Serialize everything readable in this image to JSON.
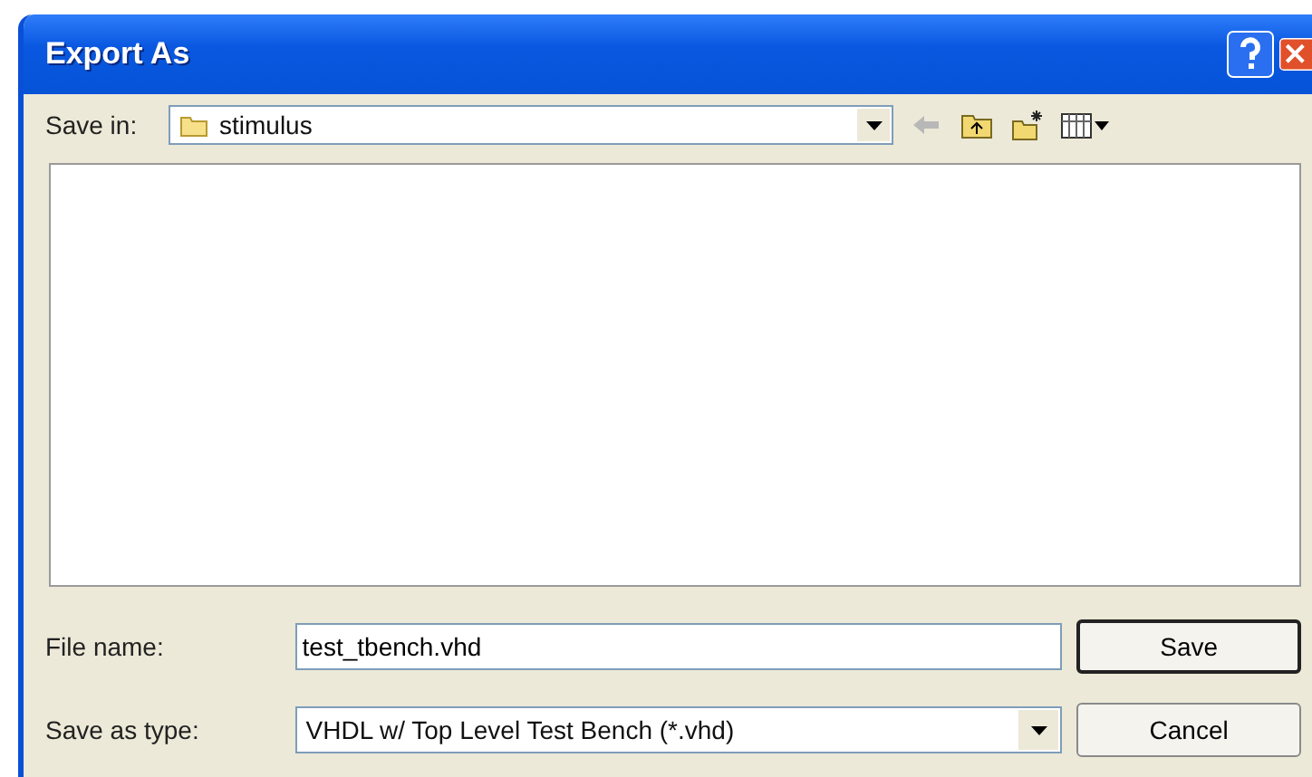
{
  "window": {
    "title": "Export As"
  },
  "save_in": {
    "label": "Save in:",
    "value": "stimulus"
  },
  "file_name": {
    "label": "File name:",
    "value": "test_tbench.vhd"
  },
  "save_as_type": {
    "label": "Save as type:",
    "value": "VHDL w/ Top Level Test Bench (*.vhd)"
  },
  "buttons": [
    {
      "label": "Save",
      "default": true
    },
    {
      "label": "Cancel",
      "default": false
    }
  ]
}
